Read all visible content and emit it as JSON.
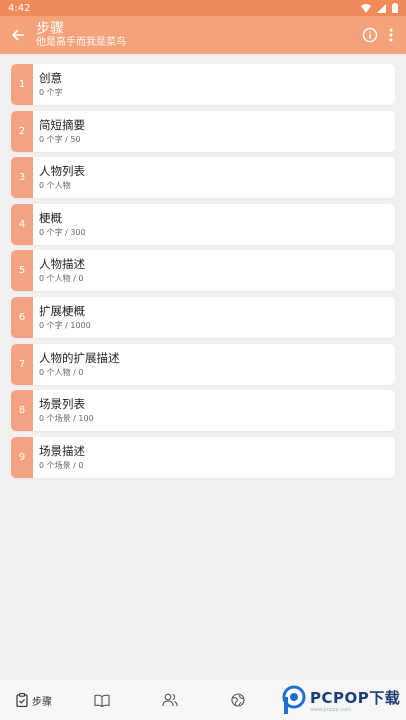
{
  "status": {
    "time": "4:42"
  },
  "header": {
    "title": "步骤",
    "subtitle": "他是高手而我是菜鸟"
  },
  "steps": [
    {
      "num": "1",
      "title": "创意",
      "detail": "0 个字"
    },
    {
      "num": "2",
      "title": "简短摘要",
      "detail": "0 个字 / 50"
    },
    {
      "num": "3",
      "title": "人物列表",
      "detail": "0 个人物"
    },
    {
      "num": "4",
      "title": "梗概",
      "detail": "0 个字 / 300"
    },
    {
      "num": "5",
      "title": "人物描述",
      "detail": "0 个人物 / 0"
    },
    {
      "num": "6",
      "title": "扩展梗概",
      "detail": "0 个字 / 1000"
    },
    {
      "num": "7",
      "title": "人物的扩展描述",
      "detail": "0 个人物 / 0"
    },
    {
      "num": "8",
      "title": "场景列表",
      "detail": "0 个场景 / 100"
    },
    {
      "num": "9",
      "title": "场景描述",
      "detail": "0 个场景 / 0"
    }
  ],
  "bottom_nav": {
    "steps_label": "步骤"
  },
  "watermark": {
    "main": "PCPOP下载",
    "sub": "www.pcpop.com"
  },
  "colors": {
    "status_bar": "#f08a5b",
    "app_bar": "#f3a27a",
    "step_badge": "#f3a384",
    "background": "#f0f0f0"
  }
}
